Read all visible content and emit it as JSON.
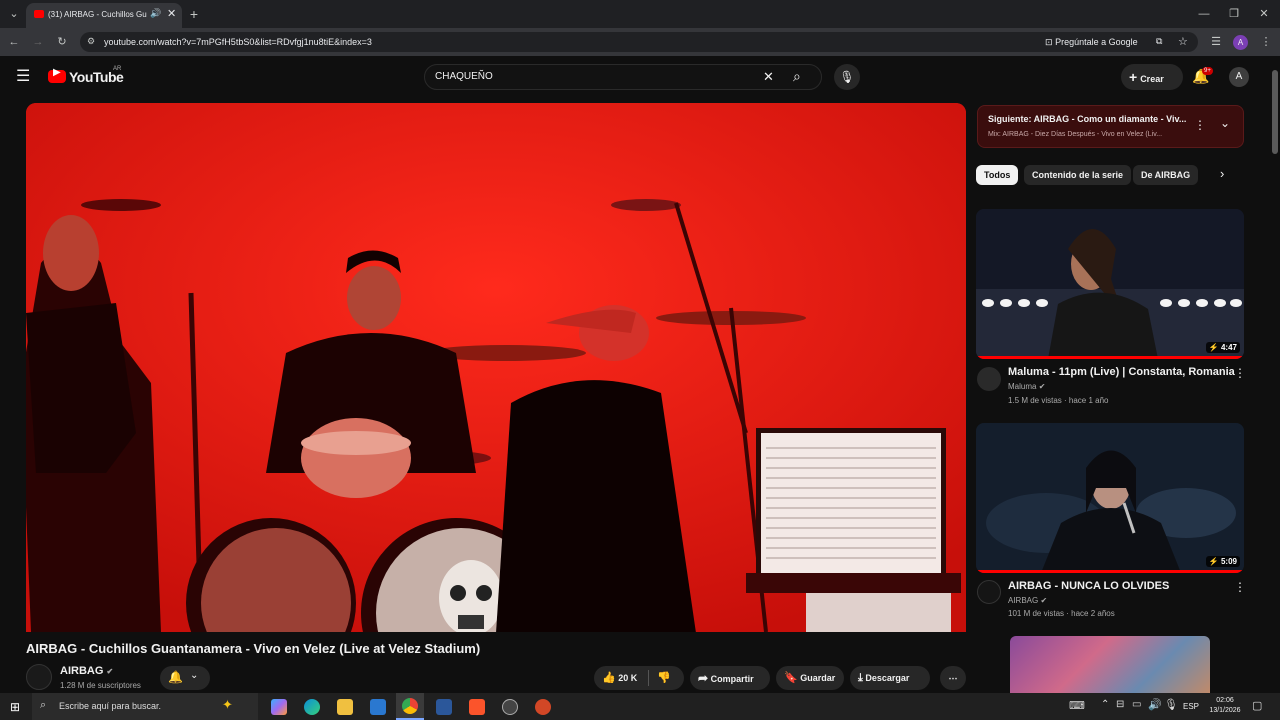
{
  "browser": {
    "tab_title": "(31) AIRBAG - Cuchillos Gu",
    "url": "youtube.com/watch?v=7mPGfH5tbS0&list=RDvfgj1nu8tiE&index=3",
    "ask_google": "Pregúntale a Google",
    "profile_initial": "A"
  },
  "youtube": {
    "logo_text": "YouTube",
    "region": "AR",
    "search_value": "CHAQUEÑO",
    "create_label": "Crear",
    "notifications_badge": "9+",
    "avatar_initial": "A"
  },
  "video": {
    "title": "AIRBAG - Cuchillos Guantanamera - Vivo en Velez (Live at Velez Stadium)",
    "channel": "AIRBAG",
    "subscribers": "1.28 M de suscriptores",
    "likes": "20 K",
    "share_label": "Compartir",
    "save_label": "Guardar",
    "download_label": "Descargar"
  },
  "playlist": {
    "next_label": "Siguiente: AIRBAG - Como un diamante - Viv...",
    "mix_label": "Mix: AIRBAG - Diez Días Después - Vivo en Velez (Liv..."
  },
  "chips": [
    "Todos",
    "Contenido de la serie",
    "De AIRBAG"
  ],
  "recommendations": [
    {
      "title": "Maluma - 11pm (Live) | Constanta, Romania",
      "channel": "Maluma",
      "meta": "1.5 M de vistas · hace 1 año",
      "duration": "4:47"
    },
    {
      "title": "AIRBAG - NUNCA LO OLVIDES",
      "channel": "AIRBAG",
      "meta": "101 M de vistas · hace 2 años",
      "duration": "5:09"
    }
  ],
  "taskbar": {
    "search_placeholder": "Escribe aquí para buscar.",
    "language": "ESP",
    "time": "02:06",
    "date": "13/1/2026"
  },
  "colors": {
    "youtube_red": "#ff0000",
    "stage_red": "#e5130d",
    "bg": "#0f0f0f"
  }
}
